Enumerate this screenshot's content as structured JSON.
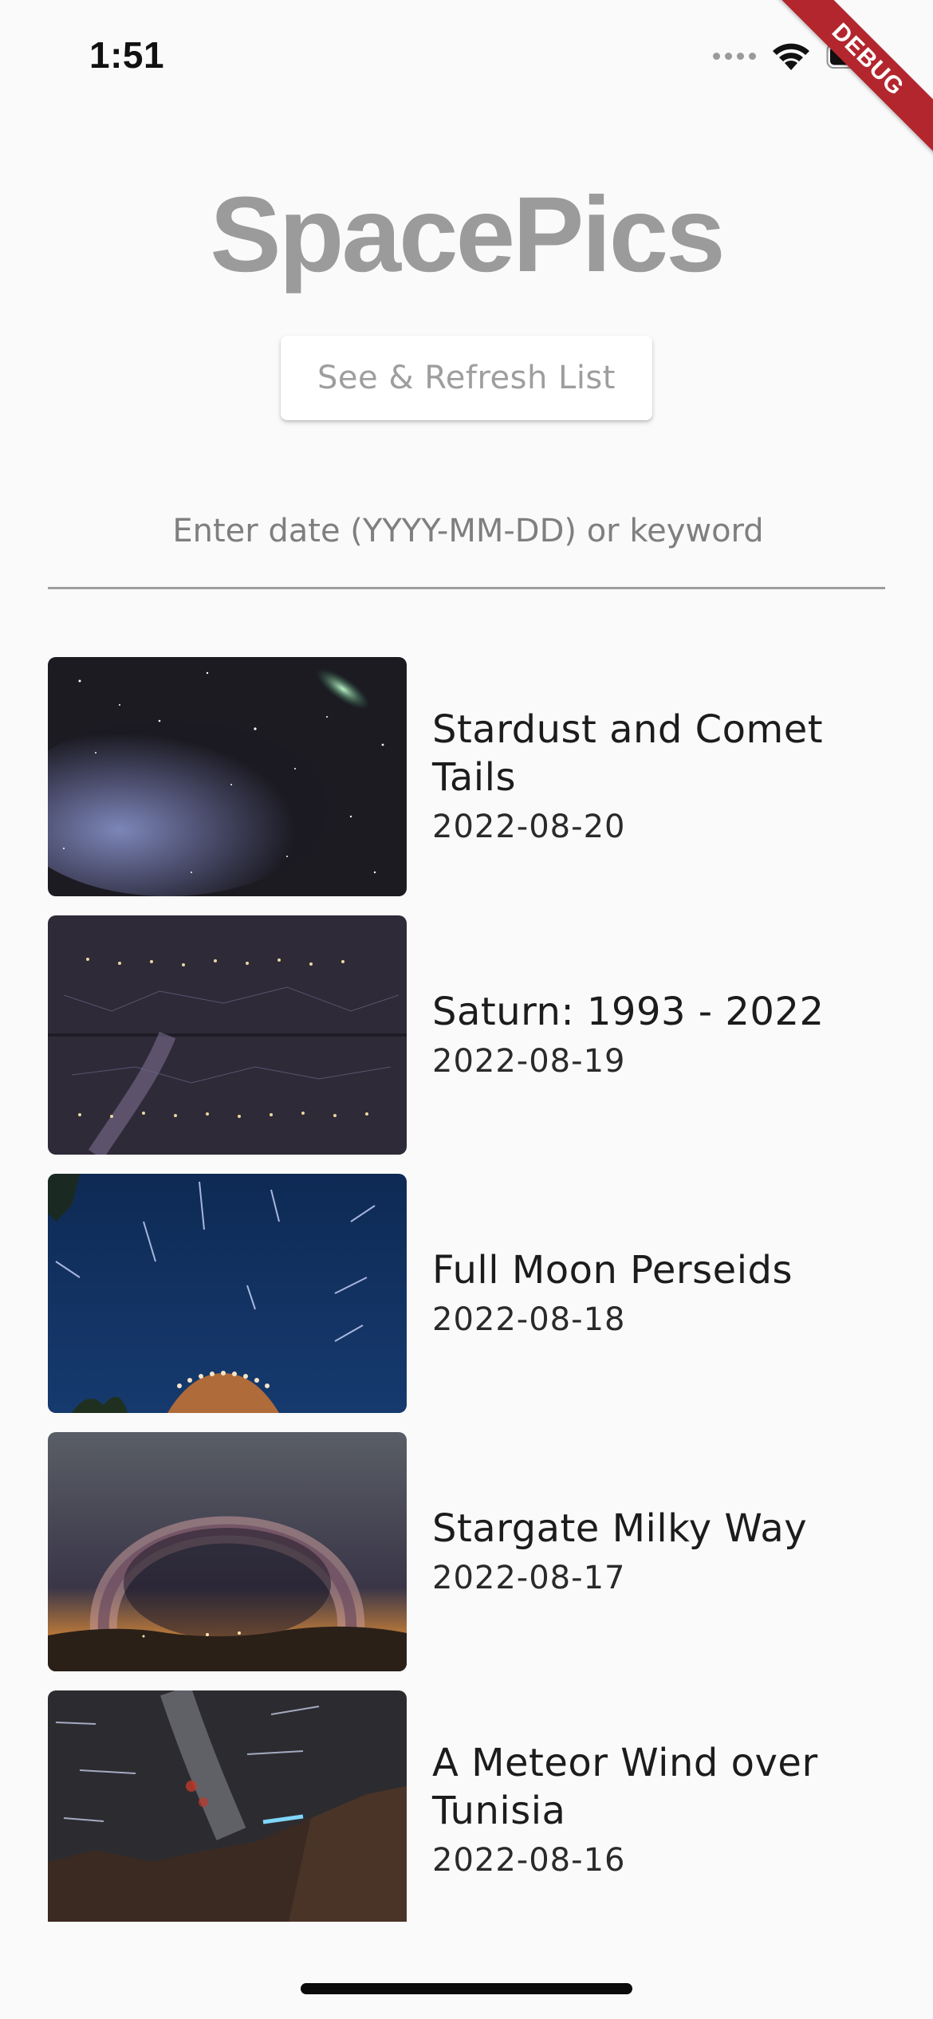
{
  "status_bar": {
    "time": "1:51",
    "icons": [
      "cellular-signal-icon",
      "wifi-icon",
      "battery-icon"
    ]
  },
  "debug_banner": "DEBUG",
  "header": {
    "title": "SpacePics"
  },
  "actions": {
    "refresh_label": "See & Refresh List"
  },
  "search": {
    "placeholder": "Enter date (YYYY-MM-DD) or keyword",
    "value": ""
  },
  "pictures": [
    {
      "title": "Stardust and Comet Tails",
      "date": "2022-08-20"
    },
    {
      "title": "Saturn: 1993 - 2022",
      "date": "2022-08-19"
    },
    {
      "title": "Full Moon Perseids",
      "date": "2022-08-18"
    },
    {
      "title": "Stargate Milky Way",
      "date": "2022-08-17"
    },
    {
      "title": "A Meteor Wind over Tunisia",
      "date": "2022-08-16"
    }
  ],
  "colors": {
    "background": "#fafafa",
    "title_gray": "#9b9b9b",
    "debug_red": "#b3262e"
  }
}
